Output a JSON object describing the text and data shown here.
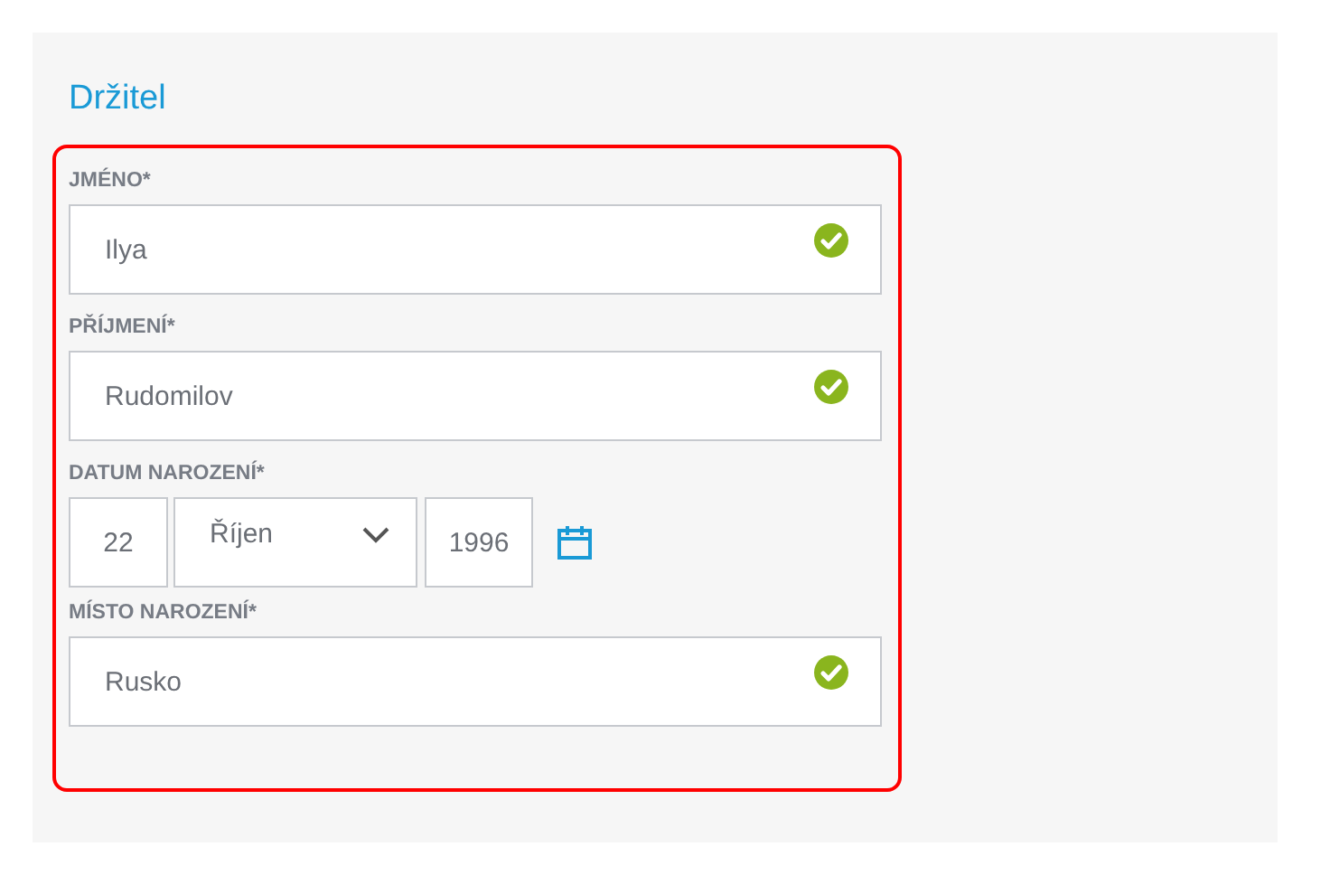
{
  "section_title": "Držitel",
  "fields": [
    {
      "kind": "text",
      "label": "JMÉNO*",
      "value": "Ilya",
      "valid": true
    },
    {
      "kind": "text",
      "label": "PŘÍJMENÍ*",
      "value": "Rudomilov",
      "valid": true
    },
    {
      "kind": "date",
      "label": "DATUM NAROZENÍ*",
      "day": "22",
      "month": "Říjen",
      "year": "1996"
    },
    {
      "kind": "text",
      "label": "MÍSTO NAROZENÍ*",
      "value": "Rusko",
      "valid": true
    }
  ]
}
